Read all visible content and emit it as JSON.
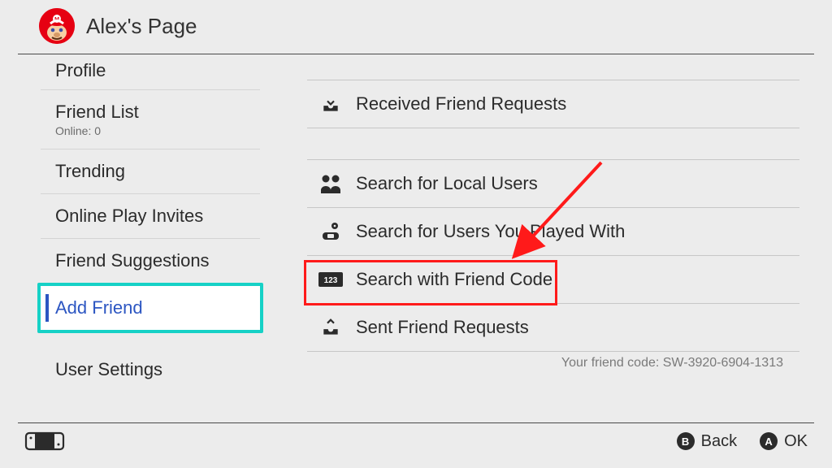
{
  "header": {
    "title": "Alex's Page"
  },
  "sidebar": {
    "items": [
      {
        "label": "Profile"
      },
      {
        "label": "Friend List",
        "sub": "Online: 0"
      },
      {
        "label": "Trending"
      },
      {
        "label": "Online Play Invites"
      },
      {
        "label": "Friend Suggestions"
      },
      {
        "label": "Add Friend"
      },
      {
        "label": "User Settings"
      }
    ]
  },
  "main": {
    "items": [
      {
        "label": "Received Friend Requests"
      },
      {
        "label": "Search for Local Users"
      },
      {
        "label": "Search for Users You Played With"
      },
      {
        "label": "Search with Friend Code"
      },
      {
        "label": "Sent Friend Requests"
      }
    ],
    "friend_code_label": "Your friend code: SW-3920-6904-1313"
  },
  "footer": {
    "back": "Back",
    "ok": "OK"
  }
}
